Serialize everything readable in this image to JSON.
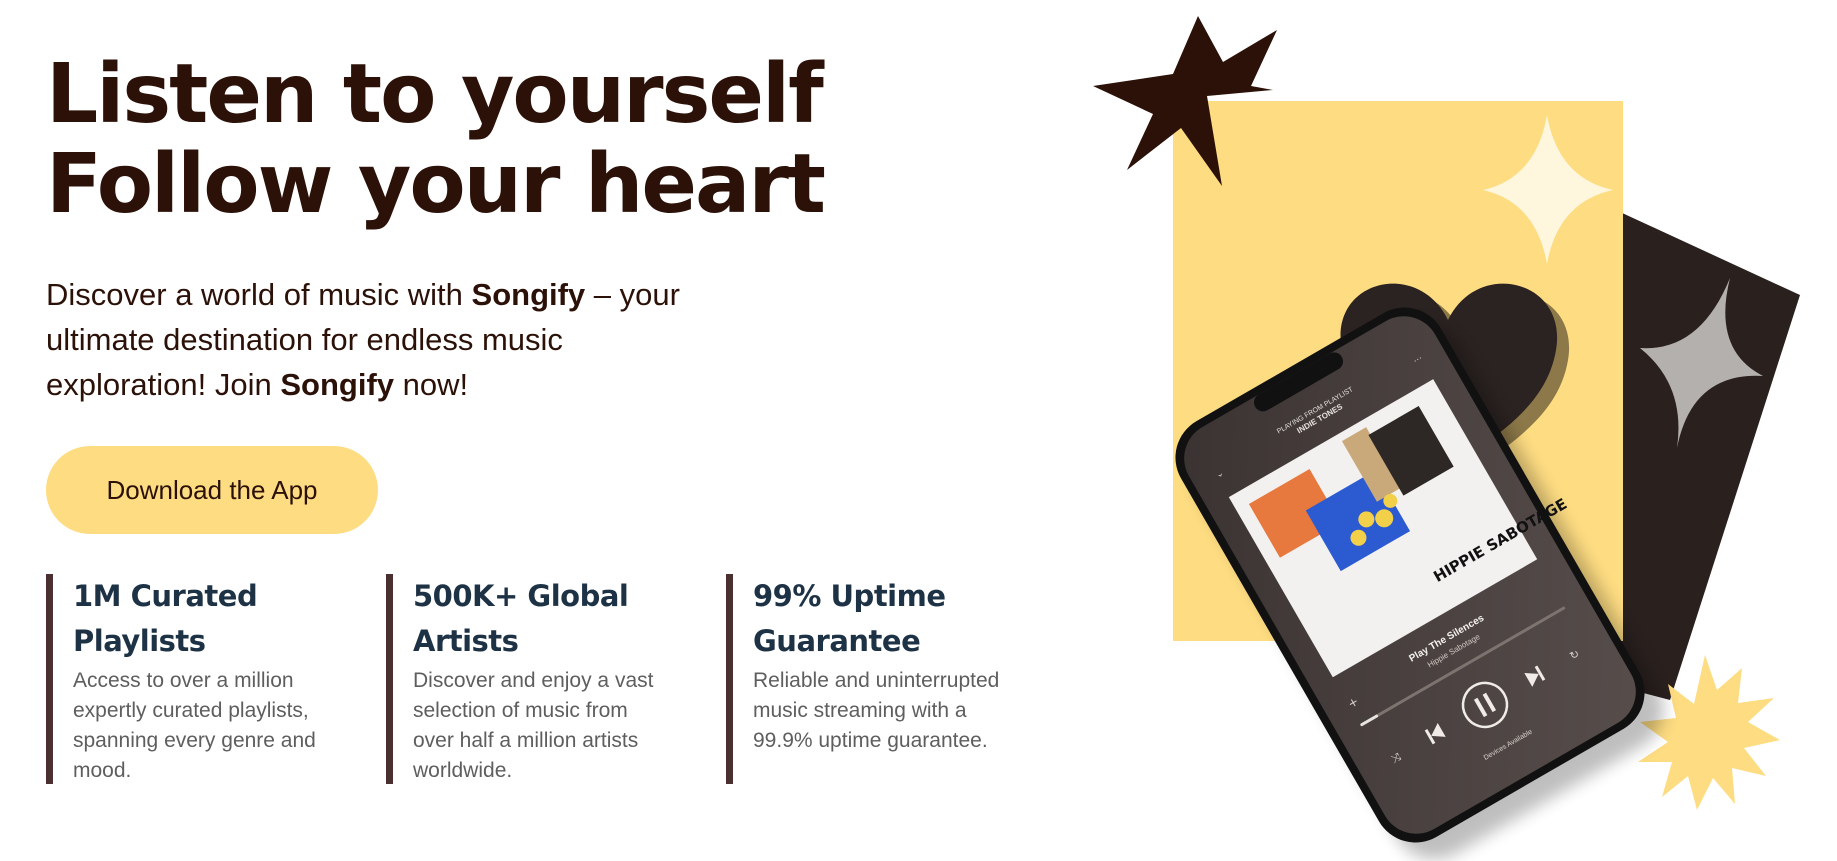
{
  "hero": {
    "title_line1": "Listen to yourself",
    "title_line2": "Follow your heart",
    "desc_part1": "Discover a world of music with ",
    "desc_brand1": "Songify",
    "desc_part2": " – your ultimate destination for endless music exploration! Join ",
    "desc_brand2": "Songify",
    "desc_part3": " now!",
    "cta_label": "Download the App"
  },
  "features": [
    {
      "title": "1M Curated Playlists",
      "desc": "Access to over a million expertly curated playlists, spanning every genre and mood."
    },
    {
      "title": "500K+ Global Artists",
      "desc": "Discover and enjoy a vast selection of music from over half a million artists worldwide."
    },
    {
      "title": "99% Uptime Guarantee",
      "desc": "Reliable and uninterrupted music streaming with a 99.9% uptime guarantee."
    }
  ],
  "phone": {
    "playing_from": "PLAYING FROM PLAYLIST",
    "playlist_name": "INDIE TONES",
    "album_text": "HIPPIE SABOTAGE",
    "track_title": "Play The Silences",
    "track_artist": "Hippie Sabotage",
    "devices_label": "Devices Available"
  },
  "colors": {
    "accent_yellow": "#fddc82",
    "dark_brown": "#2b1108",
    "feature_title": "#1e3246",
    "feature_text": "#5e5e5e",
    "divider": "#4a3030",
    "dark_panel": "#2a211f"
  },
  "icons": {
    "star": "star-icon",
    "sparkle": "sparkle-icon",
    "heart": "heart-icon",
    "burst": "burst-icon"
  }
}
